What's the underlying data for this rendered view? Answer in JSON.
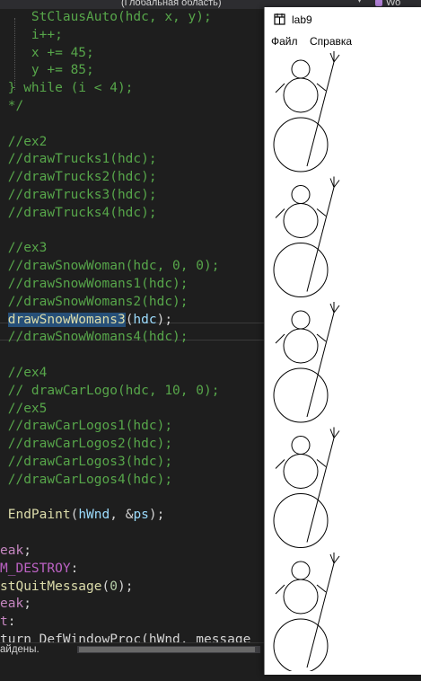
{
  "ide": {
    "scope_label": "(Глобальная область)",
    "scope_chevron": "▾",
    "right_partial": "Wo",
    "code": [
      {
        "tokens": [
          {
            "t": "    ",
            "c": "p"
          },
          {
            "t": "StClausAuto(hdc, x, y);",
            "c": "c"
          }
        ]
      },
      {
        "tokens": [
          {
            "t": "    ",
            "c": "p"
          },
          {
            "t": "i++;",
            "c": "c"
          }
        ]
      },
      {
        "tokens": [
          {
            "t": "    ",
            "c": "p"
          },
          {
            "t": "x += 45;",
            "c": "c"
          }
        ]
      },
      {
        "tokens": [
          {
            "t": "    ",
            "c": "p"
          },
          {
            "t": "y += 85;",
            "c": "c"
          }
        ]
      },
      {
        "tokens": [
          {
            "t": " ",
            "c": "p"
          },
          {
            "t": "} while (i < 4);",
            "c": "c"
          }
        ]
      },
      {
        "tokens": [
          {
            "t": " ",
            "c": "p"
          },
          {
            "t": "*/",
            "c": "c"
          }
        ]
      },
      {
        "tokens": []
      },
      {
        "tokens": [
          {
            "t": " ",
            "c": "p"
          },
          {
            "t": "//ex2",
            "c": "c"
          }
        ]
      },
      {
        "tokens": [
          {
            "t": " ",
            "c": "p"
          },
          {
            "t": "//drawTrucks1(hdc);",
            "c": "c"
          }
        ]
      },
      {
        "tokens": [
          {
            "t": " ",
            "c": "p"
          },
          {
            "t": "//drawTrucks2(hdc);",
            "c": "c"
          }
        ]
      },
      {
        "tokens": [
          {
            "t": " ",
            "c": "p"
          },
          {
            "t": "//drawTrucks3(hdc);",
            "c": "c"
          }
        ]
      },
      {
        "tokens": [
          {
            "t": " ",
            "c": "p"
          },
          {
            "t": "//drawTrucks4(hdc);",
            "c": "c"
          }
        ]
      },
      {
        "tokens": []
      },
      {
        "tokens": [
          {
            "t": " ",
            "c": "p"
          },
          {
            "t": "//ex3",
            "c": "c"
          }
        ]
      },
      {
        "tokens": [
          {
            "t": " ",
            "c": "p"
          },
          {
            "t": "//drawSnowWoman(hdc, 0, 0);",
            "c": "c"
          }
        ]
      },
      {
        "tokens": [
          {
            "t": " ",
            "c": "p"
          },
          {
            "t": "//drawSnowWomans1(hdc);",
            "c": "c"
          }
        ]
      },
      {
        "tokens": [
          {
            "t": " ",
            "c": "p"
          },
          {
            "t": "//drawSnowWomans2(hdc);",
            "c": "c"
          }
        ]
      },
      {
        "tokens": [
          {
            "t": " ",
            "c": "p"
          },
          {
            "t": "drawSnowWomans3",
            "c": "f sel"
          },
          {
            "t": "(",
            "c": "p"
          },
          {
            "t": "hdc",
            "c": "v"
          },
          {
            "t": ");",
            "c": "p"
          }
        ]
      },
      {
        "tokens": [
          {
            "t": " ",
            "c": "p"
          },
          {
            "t": "//drawSnowWomans4(hdc);",
            "c": "c"
          }
        ]
      },
      {
        "tokens": []
      },
      {
        "tokens": [
          {
            "t": " ",
            "c": "p"
          },
          {
            "t": "//ex4",
            "c": "c"
          }
        ]
      },
      {
        "tokens": [
          {
            "t": " ",
            "c": "p"
          },
          {
            "t": "// drawCarLogo(hdc, 10, 0);",
            "c": "c"
          }
        ]
      },
      {
        "tokens": [
          {
            "t": " ",
            "c": "p"
          },
          {
            "t": "//ex5",
            "c": "c"
          }
        ]
      },
      {
        "tokens": [
          {
            "t": " ",
            "c": "p"
          },
          {
            "t": "//drawCarLogos1(hdc);",
            "c": "c"
          }
        ]
      },
      {
        "tokens": [
          {
            "t": " ",
            "c": "p"
          },
          {
            "t": "//drawCarLogos2(hdc);",
            "c": "c"
          }
        ]
      },
      {
        "tokens": [
          {
            "t": " ",
            "c": "p"
          },
          {
            "t": "//drawCarLogos3(hdc);",
            "c": "c"
          }
        ]
      },
      {
        "tokens": [
          {
            "t": " ",
            "c": "p"
          },
          {
            "t": "//drawCarLogos4(hdc);",
            "c": "c"
          }
        ]
      },
      {
        "tokens": []
      },
      {
        "tokens": [
          {
            "t": " ",
            "c": "p"
          },
          {
            "t": "EndPaint",
            "c": "f"
          },
          {
            "t": "(",
            "c": "p"
          },
          {
            "t": "hWnd",
            "c": "v"
          },
          {
            "t": ", &",
            "c": "p"
          },
          {
            "t": "ps",
            "c": "v"
          },
          {
            "t": ");",
            "c": "p"
          }
        ]
      },
      {
        "tokens": []
      },
      {
        "tokens": [
          {
            "t": "eak",
            "c": "m"
          },
          {
            "t": ";",
            "c": "p"
          }
        ]
      },
      {
        "tokens": [
          {
            "t": "M_DESTROY",
            "c": "pr"
          },
          {
            "t": ":",
            "c": "p"
          }
        ]
      },
      {
        "tokens": [
          {
            "t": "stQuitMessage",
            "c": "f"
          },
          {
            "t": "(",
            "c": "p"
          },
          {
            "t": "0",
            "c": "n"
          },
          {
            "t": ");",
            "c": "p"
          }
        ]
      },
      {
        "tokens": [
          {
            "t": "eak",
            "c": "m"
          },
          {
            "t": ";",
            "c": "p"
          }
        ]
      },
      {
        "tokens": [
          {
            "t": "t",
            "c": "m"
          },
          {
            "t": ":",
            "c": "p"
          }
        ]
      },
      {
        "tokens": [
          {
            "t": "turn DefWindowProc(hWnd, message",
            "c": "p"
          }
        ]
      }
    ],
    "status_text": "айдены."
  },
  "window": {
    "title": "lab9",
    "menu": [
      "Файл",
      "Справка"
    ]
  },
  "drawing": {
    "snowwoman_count": 5,
    "stroke_color": "#000000",
    "background_color": "#ffffff"
  }
}
